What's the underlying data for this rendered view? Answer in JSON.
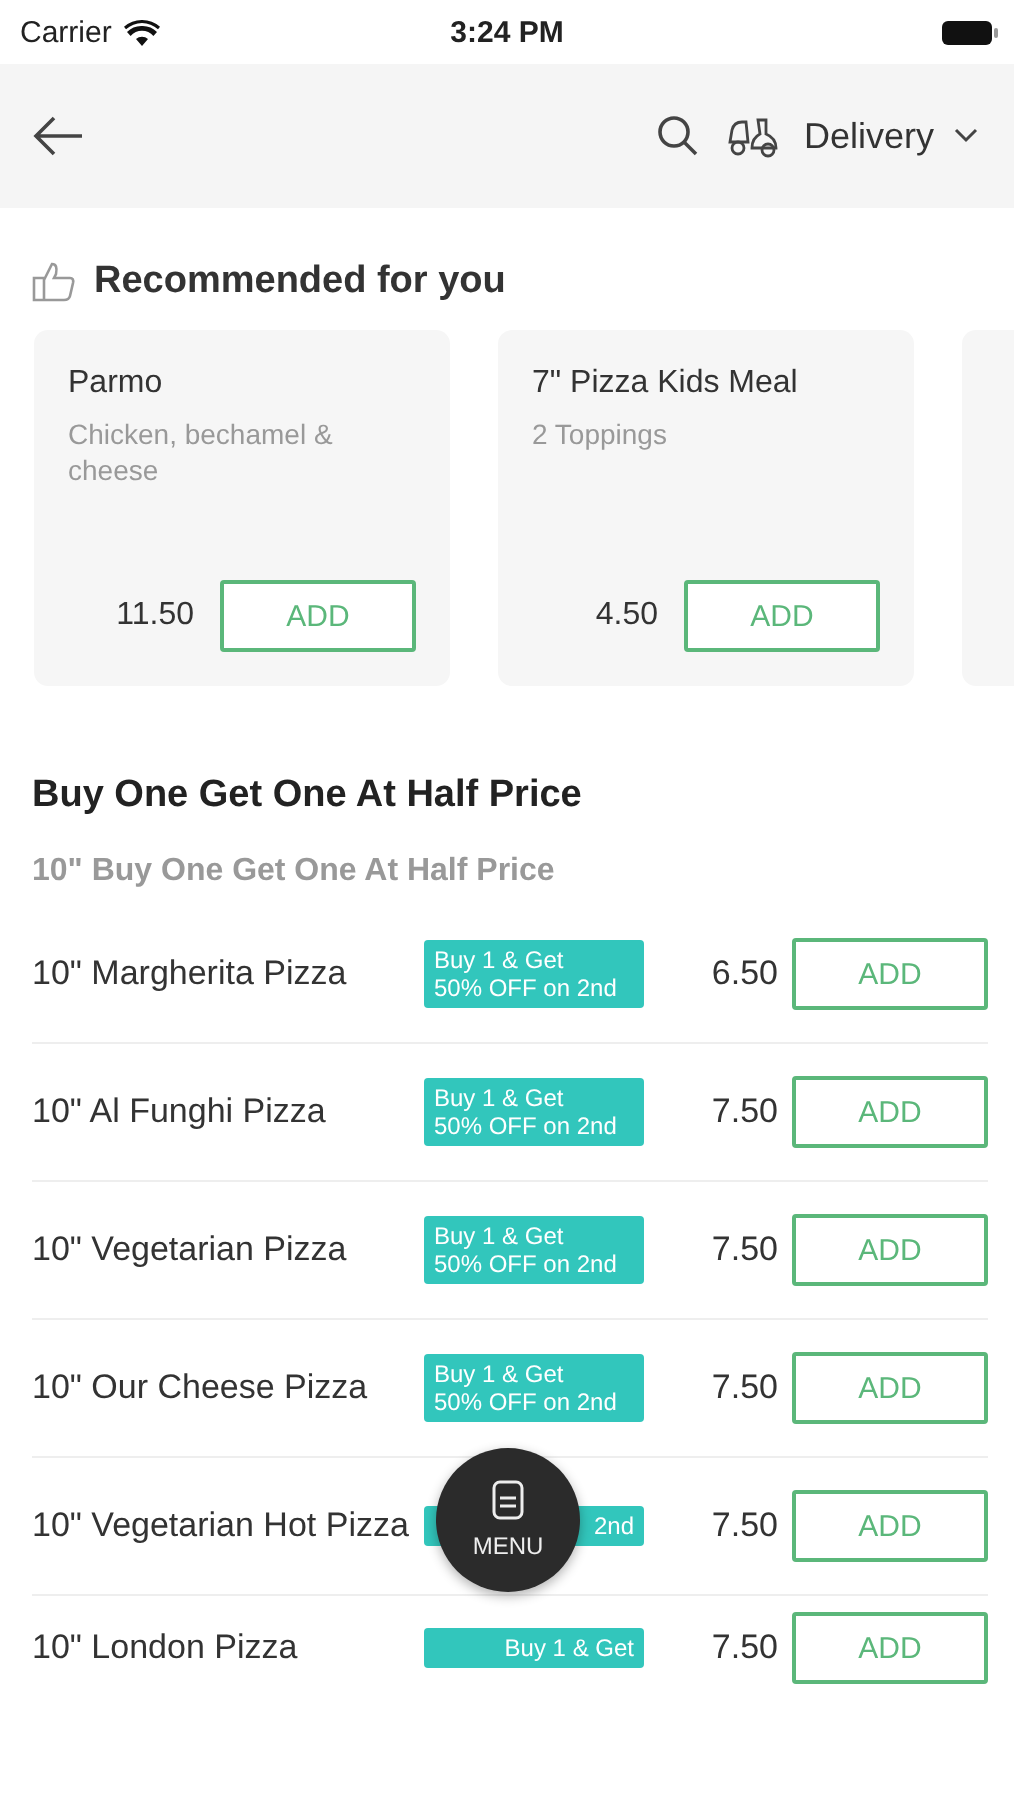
{
  "status_bar": {
    "carrier": "Carrier",
    "time": "3:24 PM"
  },
  "header": {
    "order_mode": "Delivery"
  },
  "recommended": {
    "title": "Recommended for you",
    "items": [
      {
        "kind": "product",
        "name": "Parmo",
        "description": "Chicken, bechamel & cheese",
        "price": "11.50",
        "button": "ADD"
      },
      {
        "kind": "product",
        "name": "7\" Pizza Kids Meal",
        "description": "2 Toppings",
        "price": "4.50",
        "button": "ADD"
      },
      {
        "kind": "stub"
      }
    ]
  },
  "section": {
    "title": "Buy One Get One At Half Price",
    "subtitle": "10\" Buy One Get One At Half Price",
    "items": [
      {
        "name": "10\" Margherita Pizza",
        "offer": [
          "Buy 1 & Get",
          "50% OFF on 2nd"
        ],
        "price": "6.50",
        "button": "ADD"
      },
      {
        "name": "10\" Al Funghi Pizza",
        "offer": [
          "Buy 1 & Get",
          "50% OFF on 2nd"
        ],
        "price": "7.50",
        "button": "ADD"
      },
      {
        "name": "10\" Vegetarian Pizza",
        "offer": [
          "Buy 1 & Get",
          "50% OFF on 2nd"
        ],
        "price": "7.50",
        "button": "ADD"
      },
      {
        "name": "10\" Our Cheese Pizza",
        "offer": [
          "Buy 1 & Get",
          "50% OFF on 2nd"
        ],
        "price": "7.50",
        "button": "ADD"
      },
      {
        "name": "10\" Vegetarian Hot Pizza",
        "offer": [
          "2nd"
        ],
        "price": "7.50",
        "button": "ADD"
      },
      {
        "name": "10\" London Pizza",
        "offer": [
          "Buy 1 & Get"
        ],
        "price": "7.50",
        "button": "ADD"
      }
    ]
  },
  "fab": {
    "label": "MENU"
  }
}
